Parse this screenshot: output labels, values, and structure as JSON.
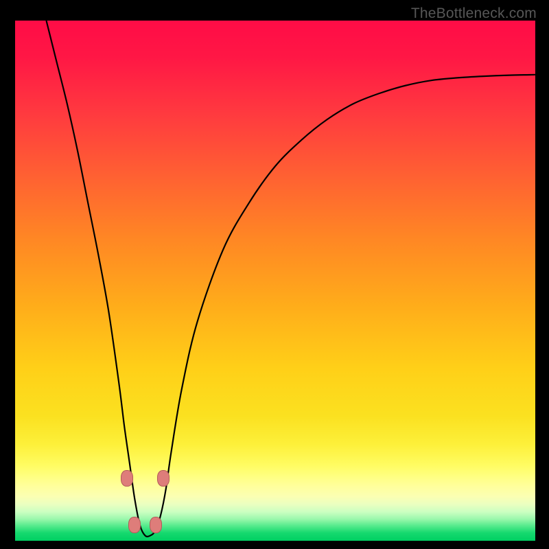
{
  "watermark": "TheBottleneck.com",
  "colors": {
    "marker_fill": "#de7d7a",
    "marker_border": "#b15a58",
    "curve_stroke": "#000000"
  },
  "chart_data": {
    "type": "line",
    "title": "",
    "xlabel": "",
    "ylabel": "",
    "xlim": [
      0,
      100
    ],
    "ylim": [
      0,
      100
    ],
    "note": "Vertical axis represents bottleneck percentage (0 at bottom / green band, 100 at top / red). Curve is a V-shape with minimum near x≈25. Values estimated from pixel positions; chart has no tick labels.",
    "series": [
      {
        "name": "bottleneck-curve",
        "x": [
          6,
          8,
          10,
          12,
          14,
          16,
          18,
          20,
          21,
          22,
          23,
          24,
          25,
          26,
          27,
          28,
          29,
          30,
          32,
          35,
          40,
          45,
          50,
          55,
          60,
          65,
          70,
          75,
          80,
          85,
          90,
          95,
          100
        ],
        "y": [
          100,
          92,
          84,
          75,
          65,
          55,
          44,
          30,
          22,
          15,
          8,
          3,
          1,
          1,
          2,
          5,
          10,
          17,
          29,
          42,
          56,
          65,
          72,
          77,
          81,
          84,
          86,
          87.5,
          88.5,
          89,
          89.3,
          89.5,
          89.6
        ]
      }
    ],
    "markers": [
      {
        "x": 21.5,
        "y": 12
      },
      {
        "x": 23.0,
        "y": 3
      },
      {
        "x": 27.0,
        "y": 3
      },
      {
        "x": 28.5,
        "y": 12
      }
    ]
  }
}
